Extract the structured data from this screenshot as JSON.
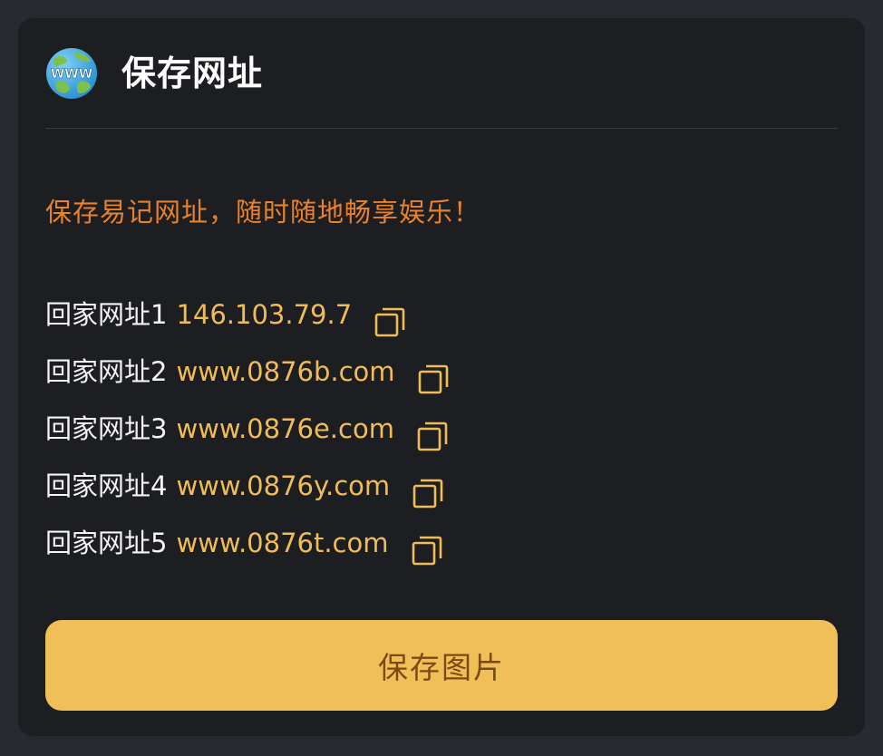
{
  "header": {
    "icon": "globe-www-icon",
    "icon_text": "WWW",
    "title": "保存网址"
  },
  "slogan": "保存易记网址，随时随地畅享娱乐！",
  "links": [
    {
      "label": "回家网址1",
      "url": "146.103.79.7"
    },
    {
      "label": "回家网址2",
      "url": "www.0876b.com"
    },
    {
      "label": "回家网址3",
      "url": "www.0876e.com"
    },
    {
      "label": "回家网址4",
      "url": "www.0876y.com"
    },
    {
      "label": "回家网址5",
      "url": "www.0876t.com"
    }
  ],
  "copy_icon": "copy-icon",
  "save_button": "保存图片",
  "colors": {
    "page_bg": "#272a30",
    "card_bg": "#1d1e22",
    "slogan": "#e8812c",
    "url": "#f0bc58",
    "button_bg": "#f1bf57",
    "button_text": "#7a4a14"
  }
}
